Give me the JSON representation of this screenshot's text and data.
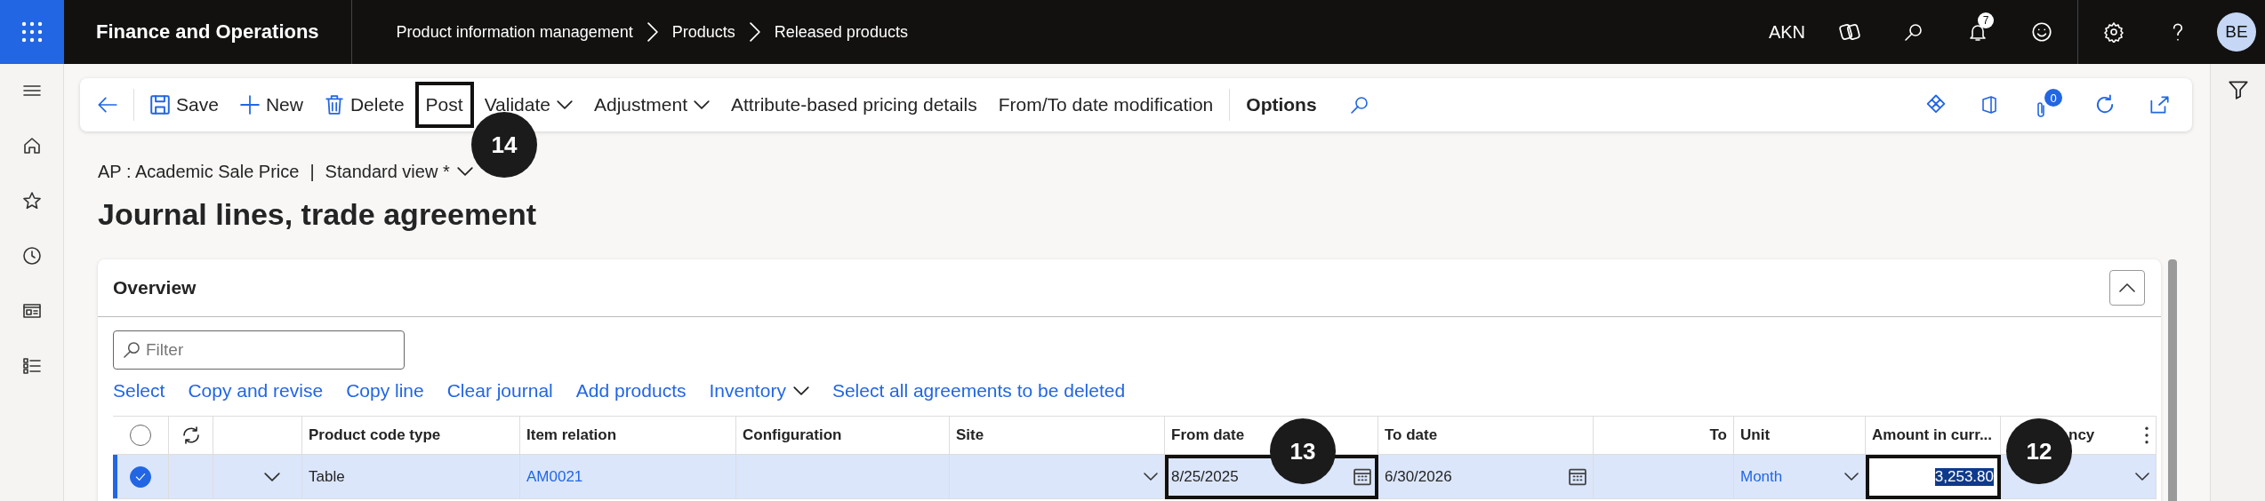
{
  "top_bar": {
    "app_name": "Finance and Operations",
    "breadcrumbs": [
      "Product information management",
      "Products",
      "Released products"
    ],
    "company": "AKN",
    "notification_count": "7",
    "avatar_initials": "BE"
  },
  "toolbar": {
    "items": [
      {
        "label": "Save",
        "kind": "save",
        "highlighted": false
      },
      {
        "label": "New",
        "kind": "new",
        "highlighted": false
      },
      {
        "label": "Delete",
        "kind": "delete",
        "highlighted": false
      },
      {
        "label": "Post",
        "kind": "plain",
        "highlighted": true
      },
      {
        "label": "Validate",
        "kind": "menu",
        "highlighted": false
      },
      {
        "label": "Adjustment",
        "kind": "menu",
        "highlighted": false
      },
      {
        "label": "Attribute-based pricing details",
        "kind": "plain",
        "highlighted": false
      },
      {
        "label": "From/To date modification",
        "kind": "plain",
        "highlighted": false
      },
      {
        "label": "Options",
        "kind": "bold",
        "highlighted": false
      }
    ],
    "attachments_count": "0"
  },
  "page": {
    "context": "AP : Academic Sale Price",
    "separator": "|",
    "view": "Standard view *",
    "title": "Journal lines, trade agreement"
  },
  "overview": {
    "title": "Overview",
    "filter_placeholder": "Filter",
    "actions": [
      {
        "label": "Select",
        "kind": "link"
      },
      {
        "label": "Copy and revise",
        "kind": "link"
      },
      {
        "label": "Copy line",
        "kind": "link"
      },
      {
        "label": "Clear journal",
        "kind": "link"
      },
      {
        "label": "Add products",
        "kind": "link"
      },
      {
        "label": "Inventory",
        "kind": "menu"
      },
      {
        "label": "Select all agreements to be deleted",
        "kind": "link"
      }
    ],
    "table": {
      "all_selected": false,
      "columns": [
        {
          "label": "Product code type",
          "kind": "text"
        },
        {
          "label": "Item relation",
          "kind": "text"
        },
        {
          "label": "Configuration",
          "kind": "text"
        },
        {
          "label": "Site",
          "kind": "text"
        },
        {
          "label": "From date",
          "kind": "text"
        },
        {
          "label": "To date",
          "kind": "text"
        },
        {
          "label": "To",
          "kind": "numeric"
        },
        {
          "label": "Unit",
          "kind": "text"
        },
        {
          "label": "Amount in curr...",
          "kind": "text"
        },
        {
          "label": "ncy",
          "kind": "covered"
        }
      ],
      "rows": [
        {
          "selected": true,
          "cells": [
            {
              "text": "Table",
              "kind": "text",
              "highlighted": false
            },
            {
              "text": "AM0021",
              "kind": "link",
              "highlighted": false
            },
            {
              "kind": "empty",
              "highlighted": false
            },
            {
              "kind": "dropdown",
              "highlighted": false
            },
            {
              "text": "8/25/2025",
              "kind": "date",
              "highlighted": true
            },
            {
              "text": "6/30/2026",
              "kind": "date",
              "highlighted": false
            },
            {
              "kind": "empty",
              "highlighted": false
            },
            {
              "text": "Month",
              "kind": "link-dropdown",
              "highlighted": false
            },
            {
              "text": "3,253.80",
              "kind": "amount",
              "highlighted": true
            },
            {
              "kind": "dropdown",
              "highlighted": false
            }
          ]
        }
      ]
    }
  },
  "callouts": [
    {
      "number": "14"
    },
    {
      "number": "13"
    },
    {
      "number": "12"
    }
  ]
}
